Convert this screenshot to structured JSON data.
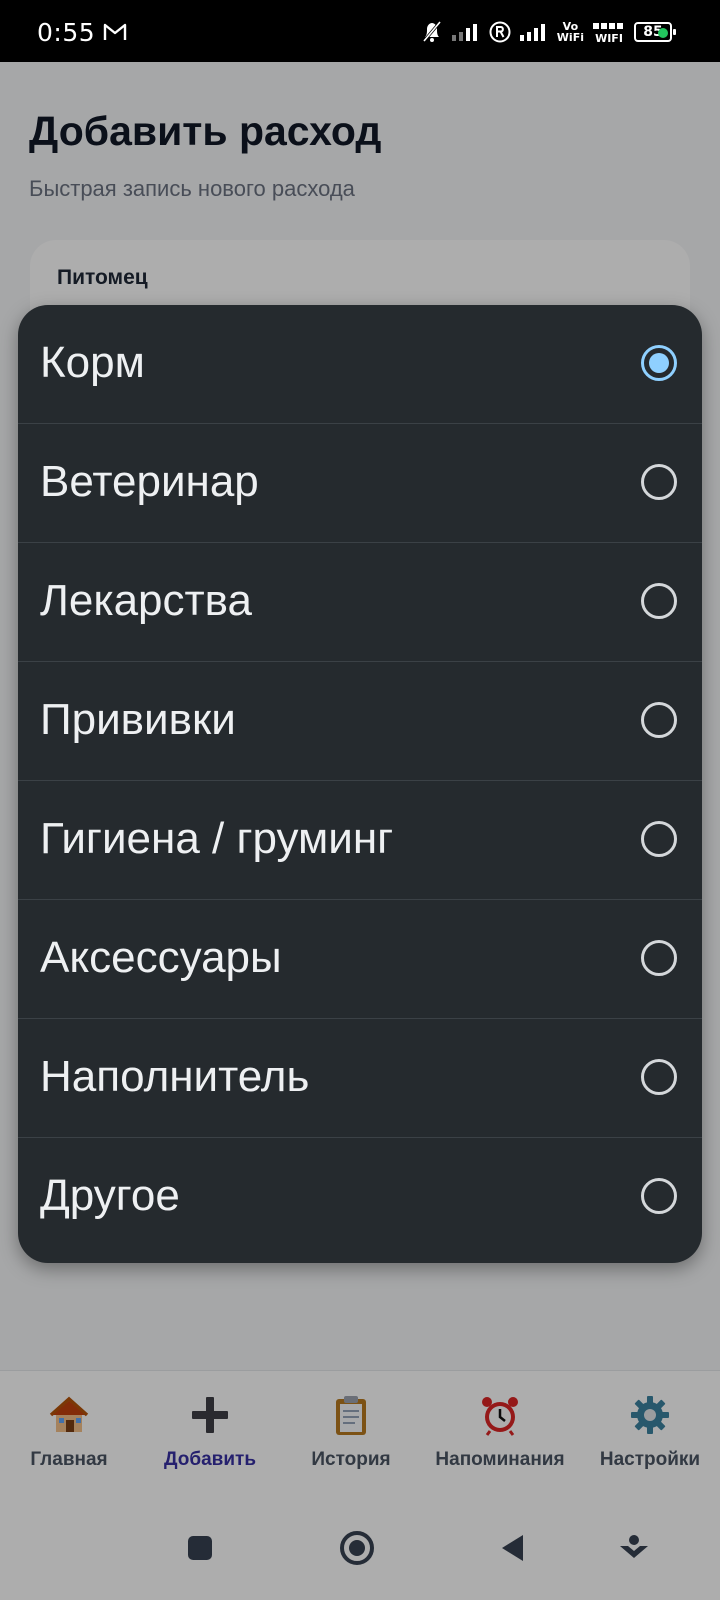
{
  "status_bar": {
    "time": "0:55",
    "vowifi_top": "Vo",
    "vowifi_bottom": "WiFi",
    "wifi_label": "WIFI",
    "battery": "85"
  },
  "page": {
    "title": "Добавить расход",
    "subtitle": "Быстрая запись нового расхода",
    "pet_label": "Питомец"
  },
  "category_dialog": {
    "options": [
      {
        "label": "Корм",
        "selected": true
      },
      {
        "label": "Ветеринар",
        "selected": false
      },
      {
        "label": "Лекарства",
        "selected": false
      },
      {
        "label": "Прививки",
        "selected": false
      },
      {
        "label": "Гигиена / груминг",
        "selected": false
      },
      {
        "label": "Аксессуары",
        "selected": false
      },
      {
        "label": "Наполнитель",
        "selected": false
      },
      {
        "label": "Другое",
        "selected": false
      }
    ]
  },
  "bottom_nav": {
    "items": [
      {
        "label": "Главная",
        "icon": "house-icon",
        "active": false
      },
      {
        "label": "Добавить",
        "icon": "plus-icon",
        "active": true
      },
      {
        "label": "История",
        "icon": "clipboard-icon",
        "active": false
      },
      {
        "label": "Напоминания",
        "icon": "alarm-clock-icon",
        "active": false
      },
      {
        "label": "Настройки",
        "icon": "gear-icon",
        "active": false
      }
    ]
  },
  "colors": {
    "active_nav": "#3730a3",
    "radio_selected": "#8fd0ff",
    "dialog_bg": "#252a2e"
  }
}
